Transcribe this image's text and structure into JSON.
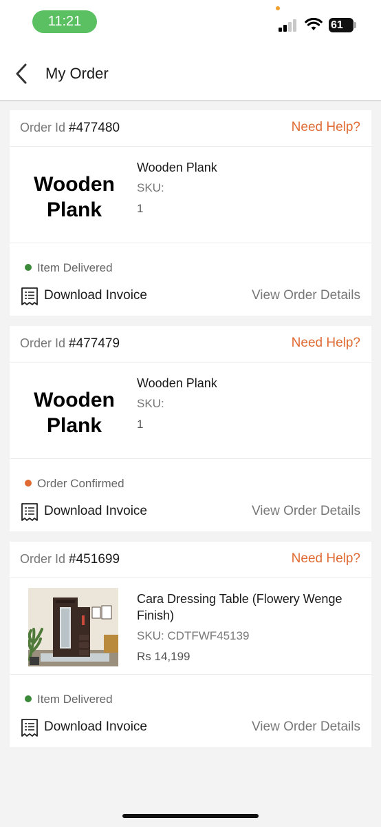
{
  "status_bar": {
    "time": "11:21",
    "battery": "61"
  },
  "header": {
    "title": "My Order"
  },
  "labels": {
    "order_id_prefix": "Order Id",
    "need_help": "Need Help?",
    "sku_label": "SKU:",
    "download_invoice": "Download Invoice",
    "view_order_details": "View Order Details"
  },
  "orders": [
    {
      "order_id": "#477480",
      "thumb_text": [
        "Wooden",
        "Plank"
      ],
      "product_name": "Wooden Plank",
      "sku": "SKU:",
      "detail": "1",
      "status": "Item Delivered",
      "status_color": "#3a8a3a"
    },
    {
      "order_id": "#477479",
      "thumb_text": [
        "Wooden",
        "Plank"
      ],
      "product_name": "Wooden Plank",
      "sku": "SKU:",
      "detail": "1",
      "status": "Order Confirmed",
      "status_color": "#e06a32"
    },
    {
      "order_id": "#451699",
      "thumb_image": "dressing-table-photo",
      "product_name": "Cara Dressing Table (Flowery Wenge Finish)",
      "sku": "SKU: CDTFWF45139",
      "detail": "Rs 14,199",
      "status": "Item Delivered",
      "status_color": "#3a8a3a"
    }
  ],
  "colors": {
    "accent": "#e06a32",
    "delivered": "#3a8a3a",
    "time_pill": "#5bc062"
  }
}
